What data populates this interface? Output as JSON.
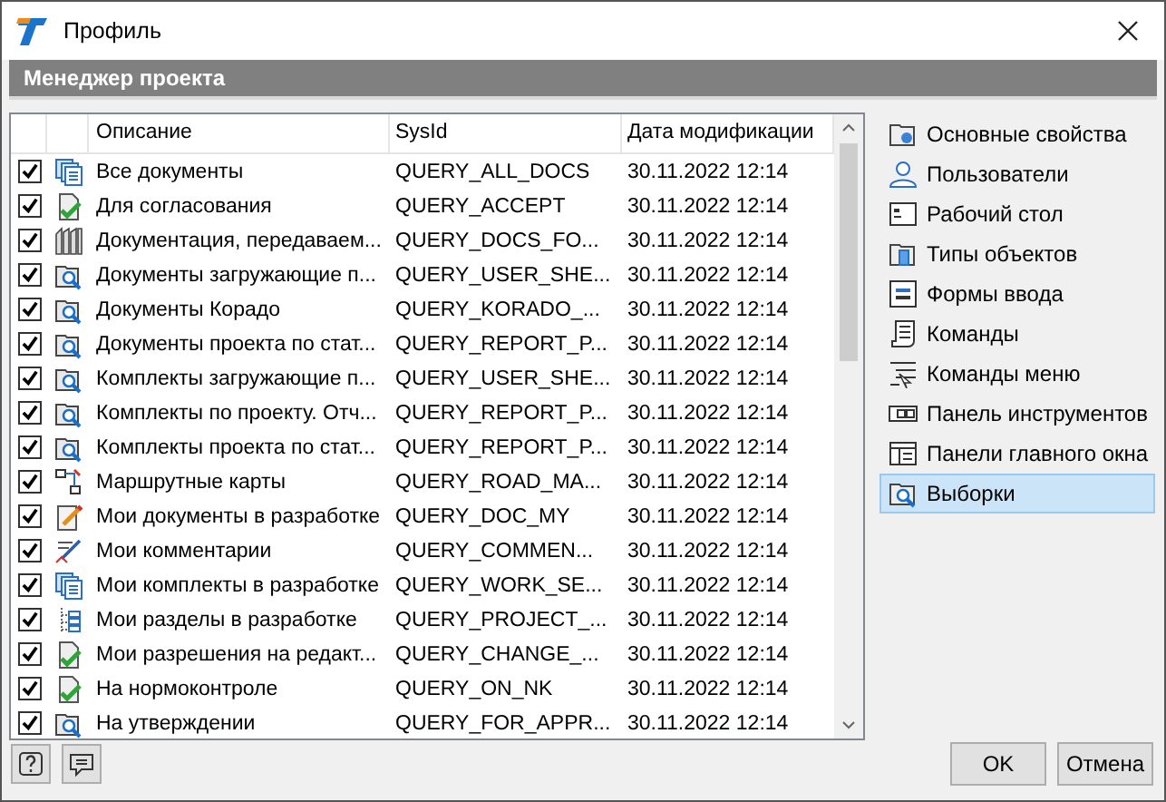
{
  "window": {
    "title": "Профиль"
  },
  "header": "Менеджер проекта",
  "table": {
    "columns": [
      "Описание",
      "SysId",
      "Дата модификации"
    ],
    "rows": [
      {
        "checked": true,
        "kind": "docs",
        "description": "Все документы",
        "sysid": "QUERY_ALL_DOCS",
        "date": "30.11.2022 12:14"
      },
      {
        "checked": true,
        "kind": "approve",
        "description": "Для согласования",
        "sysid": "QUERY_ACCEPT",
        "date": "30.11.2022 12:14"
      },
      {
        "checked": true,
        "kind": "binders",
        "description": "Документация, передаваем...",
        "sysid": "QUERY_DOCS_FO...",
        "date": "30.11.2022 12:14"
      },
      {
        "checked": true,
        "kind": "query",
        "description": "Документы загружающие п...",
        "sysid": "QUERY_USER_SHE...",
        "date": "30.11.2022 12:14"
      },
      {
        "checked": true,
        "kind": "query",
        "description": "Документы Корадо",
        "sysid": "QUERY_KORADO_...",
        "date": "30.11.2022 12:14"
      },
      {
        "checked": true,
        "kind": "query",
        "description": "Документы проекта по стат...",
        "sysid": "QUERY_REPORT_P...",
        "date": "30.11.2022 12:14"
      },
      {
        "checked": true,
        "kind": "query",
        "description": "Комплекты загружающие п...",
        "sysid": "QUERY_USER_SHE...",
        "date": "30.11.2022 12:14"
      },
      {
        "checked": true,
        "kind": "query",
        "description": "Комплекты по проекту. Отч...",
        "sysid": "QUERY_REPORT_P...",
        "date": "30.11.2022 12:14"
      },
      {
        "checked": true,
        "kind": "query",
        "description": "Комплекты проекта по стат...",
        "sysid": "QUERY_REPORT_P...",
        "date": "30.11.2022 12:14"
      },
      {
        "checked": true,
        "kind": "route",
        "description": "Маршрутные карты",
        "sysid": "QUERY_ROAD_MA...",
        "date": "30.11.2022 12:14"
      },
      {
        "checked": true,
        "kind": "edit",
        "description": "Мои документы в разработке",
        "sysid": "QUERY_DOC_MY",
        "date": "30.11.2022 12:14"
      },
      {
        "checked": true,
        "kind": "comment",
        "description": "Мои комментарии",
        "sysid": "QUERY_COMMEN...",
        "date": "30.11.2022 12:14"
      },
      {
        "checked": true,
        "kind": "docs",
        "description": "Мои комплекты в разработке",
        "sysid": "QUERY_WORK_SE...",
        "date": "30.11.2022 12:14"
      },
      {
        "checked": true,
        "kind": "tree",
        "description": "Мои разделы в разработке",
        "sysid": "QUERY_PROJECT_...",
        "date": "30.11.2022 12:14"
      },
      {
        "checked": true,
        "kind": "approve",
        "description": "Мои разрешения на редакт...",
        "sysid": "QUERY_CHANGE_...",
        "date": "30.11.2022 12:14"
      },
      {
        "checked": true,
        "kind": "approve",
        "description": "На нормоконтроле",
        "sysid": "QUERY_ON_NK",
        "date": "30.11.2022 12:14"
      },
      {
        "checked": true,
        "kind": "query",
        "description": "На утверждении",
        "sysid": "QUERY_FOR_APPR...",
        "date": "30.11.2022 12:14"
      }
    ]
  },
  "sidebar": {
    "items": [
      {
        "label": "Основные свойства",
        "kind": "folder-gear",
        "selected": false
      },
      {
        "label": "Пользователи",
        "kind": "user",
        "selected": false
      },
      {
        "label": "Рабочий стол",
        "kind": "desktop",
        "selected": false
      },
      {
        "label": "Типы объектов",
        "kind": "folder-doc",
        "selected": false
      },
      {
        "label": "Формы ввода",
        "kind": "form",
        "selected": false
      },
      {
        "label": "Команды",
        "kind": "scroll",
        "selected": false
      },
      {
        "label": "Команды меню",
        "kind": "menu",
        "selected": false
      },
      {
        "label": "Панель инструментов",
        "kind": "toolbar",
        "selected": false
      },
      {
        "label": "Панели главного окна",
        "kind": "panels",
        "selected": false
      },
      {
        "label": "Выборки",
        "kind": "folder-search",
        "selected": true
      }
    ]
  },
  "buttons": [
    "OK",
    "Отмена"
  ]
}
